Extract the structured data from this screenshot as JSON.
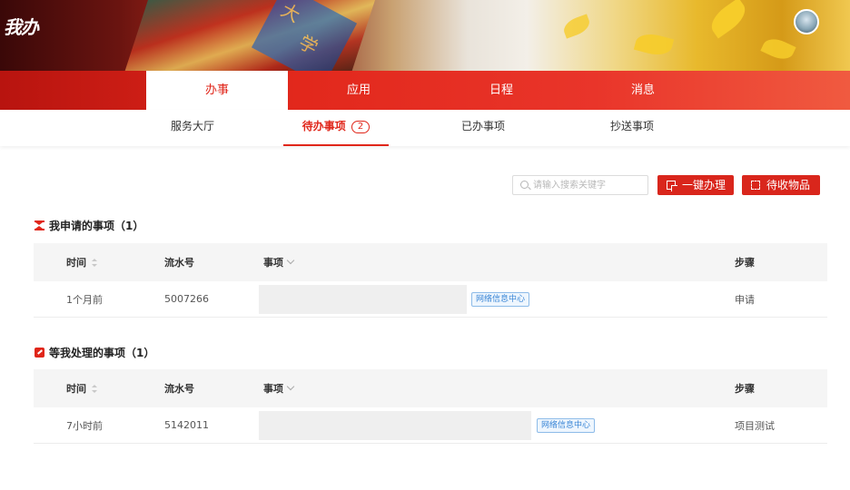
{
  "app": {
    "logo_text": "我办",
    "brand_color": "#e0261a"
  },
  "main_tabs": [
    {
      "label": "办事",
      "active": true
    },
    {
      "label": "应用",
      "active": false
    },
    {
      "label": "日程",
      "active": false
    },
    {
      "label": "消息",
      "active": false
    }
  ],
  "sub_tabs": [
    {
      "label": "服务大厅",
      "active": false
    },
    {
      "label": "待办事项",
      "active": true,
      "count": "2"
    },
    {
      "label": "已办事项",
      "active": false
    },
    {
      "label": "抄送事项",
      "active": false
    }
  ],
  "toolbar": {
    "search_placeholder": "请输入搜索关键字",
    "one_click_label": "一键办理",
    "pending_items_label": "待收物品"
  },
  "section_applied": {
    "title": "我申请的事项（1）",
    "icon": "hourglass-icon",
    "columns": {
      "time": "时间",
      "serial": "流水号",
      "item": "事项",
      "step": "步骤"
    },
    "rows": [
      {
        "time": "1个月前",
        "serial": "5007266",
        "item_tag": "网络信息中心",
        "step": "申请"
      }
    ]
  },
  "section_waiting": {
    "title": "等我处理的事项（1）",
    "icon": "edit-icon",
    "columns": {
      "time": "时间",
      "serial": "流水号",
      "item": "事项",
      "step": "步骤"
    },
    "rows": [
      {
        "time": "7小时前",
        "serial": "5142011",
        "item_tag": "网络信息中心",
        "step": "项目测试"
      }
    ]
  }
}
